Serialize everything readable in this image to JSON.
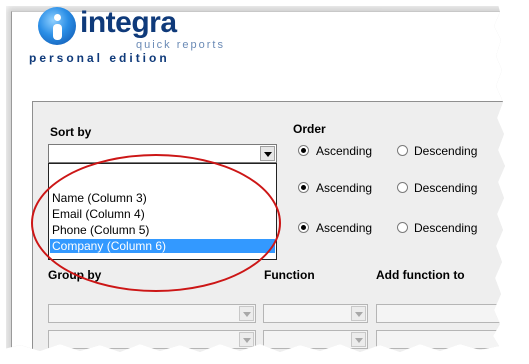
{
  "logo": {
    "main": "integra",
    "sub": "quick reports",
    "edition": "personal edition"
  },
  "sort": {
    "label": "Sort by",
    "current_value": "",
    "options": [
      "Name (Column 3)",
      "Email (Column 4)",
      "Phone (Column 5)",
      "Company (Column 6)"
    ],
    "selected_index": 3
  },
  "order": {
    "label": "Order",
    "rows": [
      {
        "ascending": "Ascending",
        "descending": "Descending",
        "selected": "ascending"
      },
      {
        "ascending": "Ascending",
        "descending": "Descending",
        "selected": "ascending"
      },
      {
        "ascending": "Ascending",
        "descending": "Descending",
        "selected": "ascending"
      }
    ]
  },
  "group": {
    "group_by_label": "Group by",
    "function_label": "Function",
    "add_function_label": "Add function to"
  },
  "colors": {
    "highlight": "#3399ff",
    "annotation": "#cc1616",
    "logo_dark": "#0f3a7a",
    "panel": "#eeeeee"
  }
}
